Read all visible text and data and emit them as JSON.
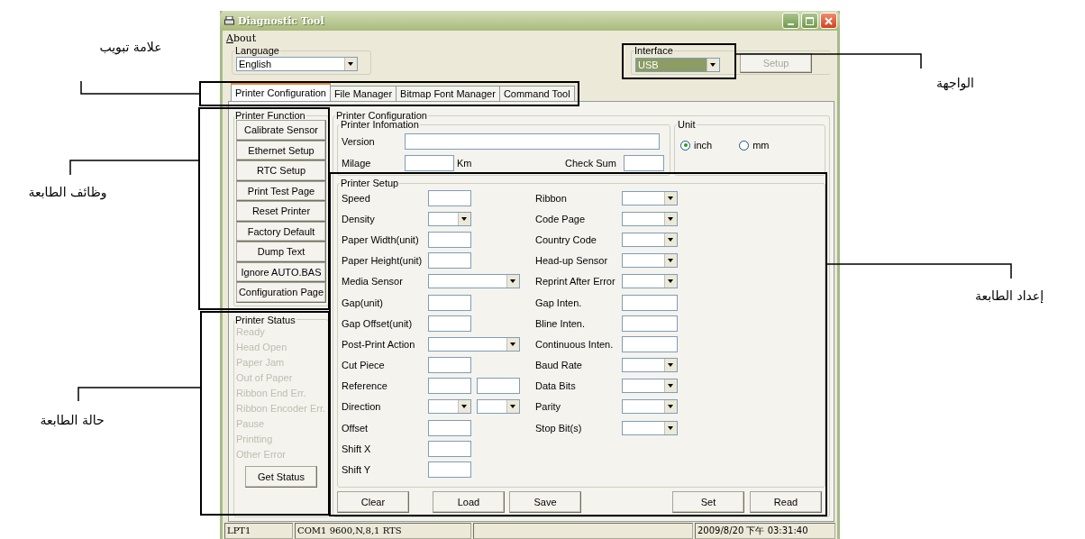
{
  "window": {
    "title": "Diagnostic Tool"
  },
  "menu": [
    "About"
  ],
  "language": {
    "label": "Language",
    "value": "English"
  },
  "interface": {
    "label": "Interface",
    "value": "USB",
    "disabled": true,
    "setup_button": "Setup"
  },
  "tabs": [
    {
      "label": "Printer Configuration",
      "selected": true
    },
    {
      "label": "File Manager",
      "selected": false
    },
    {
      "label": "Bitmap Font Manager",
      "selected": false
    },
    {
      "label": "Command Tool",
      "selected": false
    }
  ],
  "printer_function": {
    "title": "Printer Function",
    "buttons": [
      "Calibrate Sensor",
      "Ethernet Setup",
      "RTC Setup",
      "Print Test Page",
      "Reset Printer",
      "Factory Default",
      "Dump Text",
      "Ignore AUTO.BAS",
      "Configuration Page"
    ]
  },
  "printer_status": {
    "title": "Printer Status",
    "items": [
      {
        "label": "Ready",
        "active": false
      },
      {
        "label": "Head Open",
        "active": false
      },
      {
        "label": "Paper Jam",
        "active": false
      },
      {
        "label": "Out of Paper",
        "active": false
      },
      {
        "label": "Ribbon End Err.",
        "active": false
      },
      {
        "label": "Ribbon Encoder Err.",
        "active": false
      },
      {
        "label": "Pause",
        "active": false
      },
      {
        "label": "Printting",
        "active": false
      },
      {
        "label": "Other Error",
        "active": false
      }
    ],
    "button": "Get Status"
  },
  "printer_configuration": {
    "title": "Printer Configuration",
    "printer_information": {
      "title": "Printer Infomation",
      "version_label": "Version",
      "milage_label": "Milage",
      "milage_unit": "Km",
      "check_sum_label": "Check Sum"
    },
    "unit": {
      "title": "Unit",
      "options": [
        {
          "label": "inch",
          "selected": true
        },
        {
          "label": "mm",
          "selected": false
        }
      ]
    },
    "printer_setup": {
      "title": "Printer Setup",
      "left_fields": [
        {
          "label": "Speed",
          "kind": "text"
        },
        {
          "label": "Density",
          "kind": "dropdown"
        },
        {
          "label": "Paper Width(unit)",
          "kind": "text"
        },
        {
          "label": "Paper Height(unit)",
          "kind": "text"
        },
        {
          "label": "Media Sensor",
          "kind": "wide_dropdown"
        },
        {
          "label": "Gap(unit)",
          "kind": "text"
        },
        {
          "label": "Gap Offset(unit)",
          "kind": "text"
        },
        {
          "label": "Post-Print Action",
          "kind": "wide_dropdown"
        },
        {
          "label": "Cut Piece",
          "kind": "text"
        },
        {
          "label": "Reference",
          "kind": "two_text"
        },
        {
          "label": "Direction",
          "kind": "two_dropdown"
        },
        {
          "label": "Offset",
          "kind": "text"
        },
        {
          "label": "Shift X",
          "kind": "text"
        },
        {
          "label": "Shift Y",
          "kind": "text"
        }
      ],
      "right_fields": [
        {
          "label": "Ribbon",
          "kind": "dropdown"
        },
        {
          "label": "Code Page",
          "kind": "dropdown"
        },
        {
          "label": "Country Code",
          "kind": "dropdown"
        },
        {
          "label": "Head-up Sensor",
          "kind": "dropdown"
        },
        {
          "label": "Reprint After Error",
          "kind": "dropdown"
        },
        {
          "label": "Gap Inten.",
          "kind": "text"
        },
        {
          "label": "Bline Inten.",
          "kind": "text"
        },
        {
          "label": "Continuous Inten.",
          "kind": "text"
        },
        {
          "label": "Baud Rate",
          "kind": "dropdown"
        },
        {
          "label": "Data Bits",
          "kind": "dropdown"
        },
        {
          "label": "Parity",
          "kind": "dropdown"
        },
        {
          "label": "Stop Bit(s)",
          "kind": "dropdown"
        }
      ]
    },
    "buttons": [
      "Clear",
      "Load",
      "Save",
      "Set",
      "Read"
    ]
  },
  "status_bar": {
    "port": "LPT1",
    "com": "COM1 9600,N,8,1 RTS",
    "datetime": "2009/8/20 下午 03:31:40"
  },
  "callouts": [
    {
      "label": "علامة تبويب"
    },
    {
      "label": "الواجهة"
    },
    {
      "label": "وظائف الطابعة"
    },
    {
      "label": "حالة الطابعة"
    },
    {
      "label": "إعداد الطابعة"
    }
  ]
}
